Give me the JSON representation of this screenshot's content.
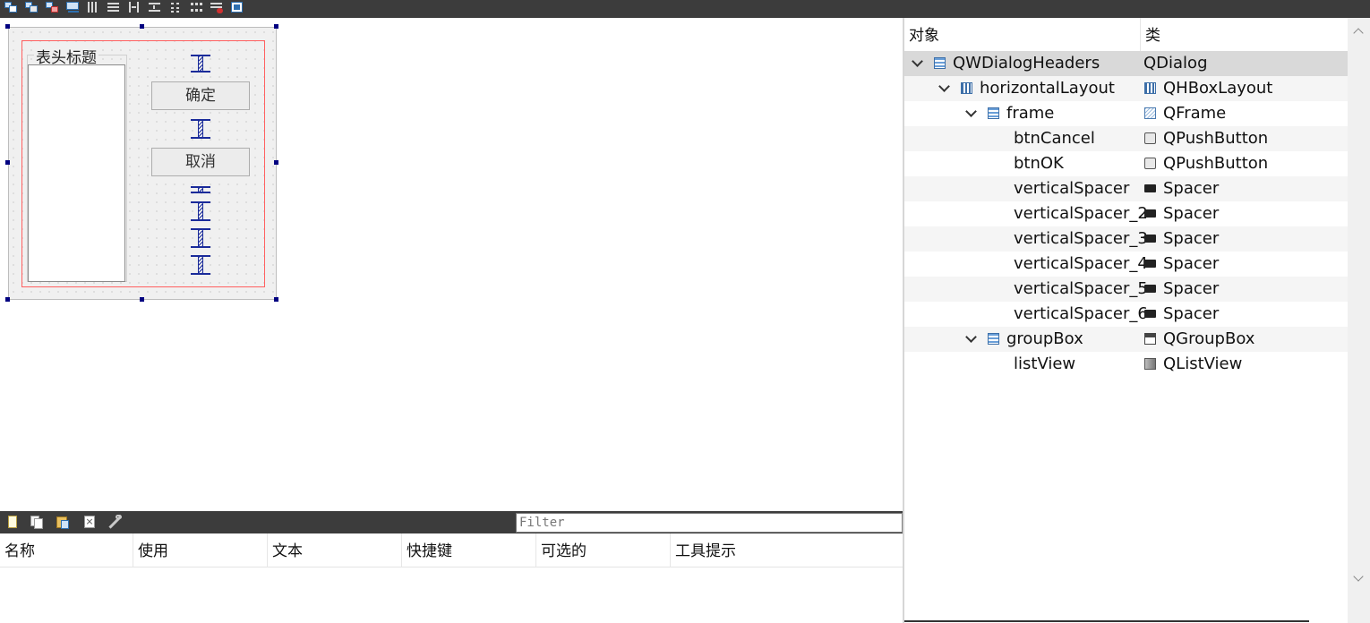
{
  "top_toolbar": {
    "icons": [
      "edit-widgets-icon",
      "edit-signals-slots-icon",
      "edit-buddies-icon",
      "edit-tab-order-icon",
      "layout-horizontal-icon",
      "layout-vertical-icon",
      "layout-horizontal-splitter-icon",
      "layout-vertical-splitter-icon",
      "layout-form-icon",
      "layout-grid-icon",
      "break-layout-icon",
      "adjust-size-icon"
    ]
  },
  "form": {
    "groupbox_title": "表头标题",
    "ok_button": "确定",
    "cancel_button": "取消"
  },
  "action_editor": {
    "filter_placeholder": "Filter",
    "columns": [
      "名称",
      "使用",
      "文本",
      "快捷键",
      "可选的",
      "工具提示"
    ],
    "icons": [
      "new-action-icon",
      "copy-action-icon",
      "paste-action-icon",
      "delete-action-icon",
      "configure-action-icon"
    ]
  },
  "object_inspector": {
    "header": {
      "object": "对象",
      "class": "类"
    },
    "rows": [
      {
        "name": "QWDialogHeaders",
        "class": "QDialog",
        "icon": "form-icon",
        "class_icon": "",
        "level": 0,
        "expanded": true
      },
      {
        "name": "horizontalLayout",
        "class": "QHBoxLayout",
        "icon": "hbox-layout-icon",
        "class_icon": "hbox-layout-icon",
        "level": 1,
        "expanded": true
      },
      {
        "name": "frame",
        "class": "QFrame",
        "icon": "form-icon",
        "class_icon": "frame-icon",
        "level": 2,
        "expanded": true
      },
      {
        "name": "btnCancel",
        "class": "QPushButton",
        "icon": "",
        "class_icon": "push-button-icon",
        "level": 3
      },
      {
        "name": "btnOK",
        "class": "QPushButton",
        "icon": "",
        "class_icon": "push-button-icon",
        "level": 3
      },
      {
        "name": "verticalSpacer",
        "class": "Spacer",
        "icon": "",
        "class_icon": "spacer-icon",
        "level": 3
      },
      {
        "name": "verticalSpacer_2",
        "class": "Spacer",
        "icon": "",
        "class_icon": "spacer-icon",
        "level": 3
      },
      {
        "name": "verticalSpacer_3",
        "class": "Spacer",
        "icon": "",
        "class_icon": "spacer-icon",
        "level": 3
      },
      {
        "name": "verticalSpacer_4",
        "class": "Spacer",
        "icon": "",
        "class_icon": "spacer-icon",
        "level": 3
      },
      {
        "name": "verticalSpacer_5",
        "class": "Spacer",
        "icon": "",
        "class_icon": "spacer-icon",
        "level": 3
      },
      {
        "name": "verticalSpacer_6",
        "class": "Spacer",
        "icon": "",
        "class_icon": "spacer-icon",
        "level": 3
      },
      {
        "name": "groupBox",
        "class": "QGroupBox",
        "icon": "form-icon",
        "class_icon": "group-box-icon",
        "level": 2,
        "expanded": true
      },
      {
        "name": "listView",
        "class": "QListView",
        "icon": "",
        "class_icon": "list-view-icon",
        "level": 3
      }
    ]
  },
  "colors": {
    "toolbar_bg": "#3c3c3c",
    "selection_handle": "#000080",
    "layout_outline": "#ff6060",
    "spacer": "#1a2b9a",
    "selected_row": "#d9d9d9"
  }
}
